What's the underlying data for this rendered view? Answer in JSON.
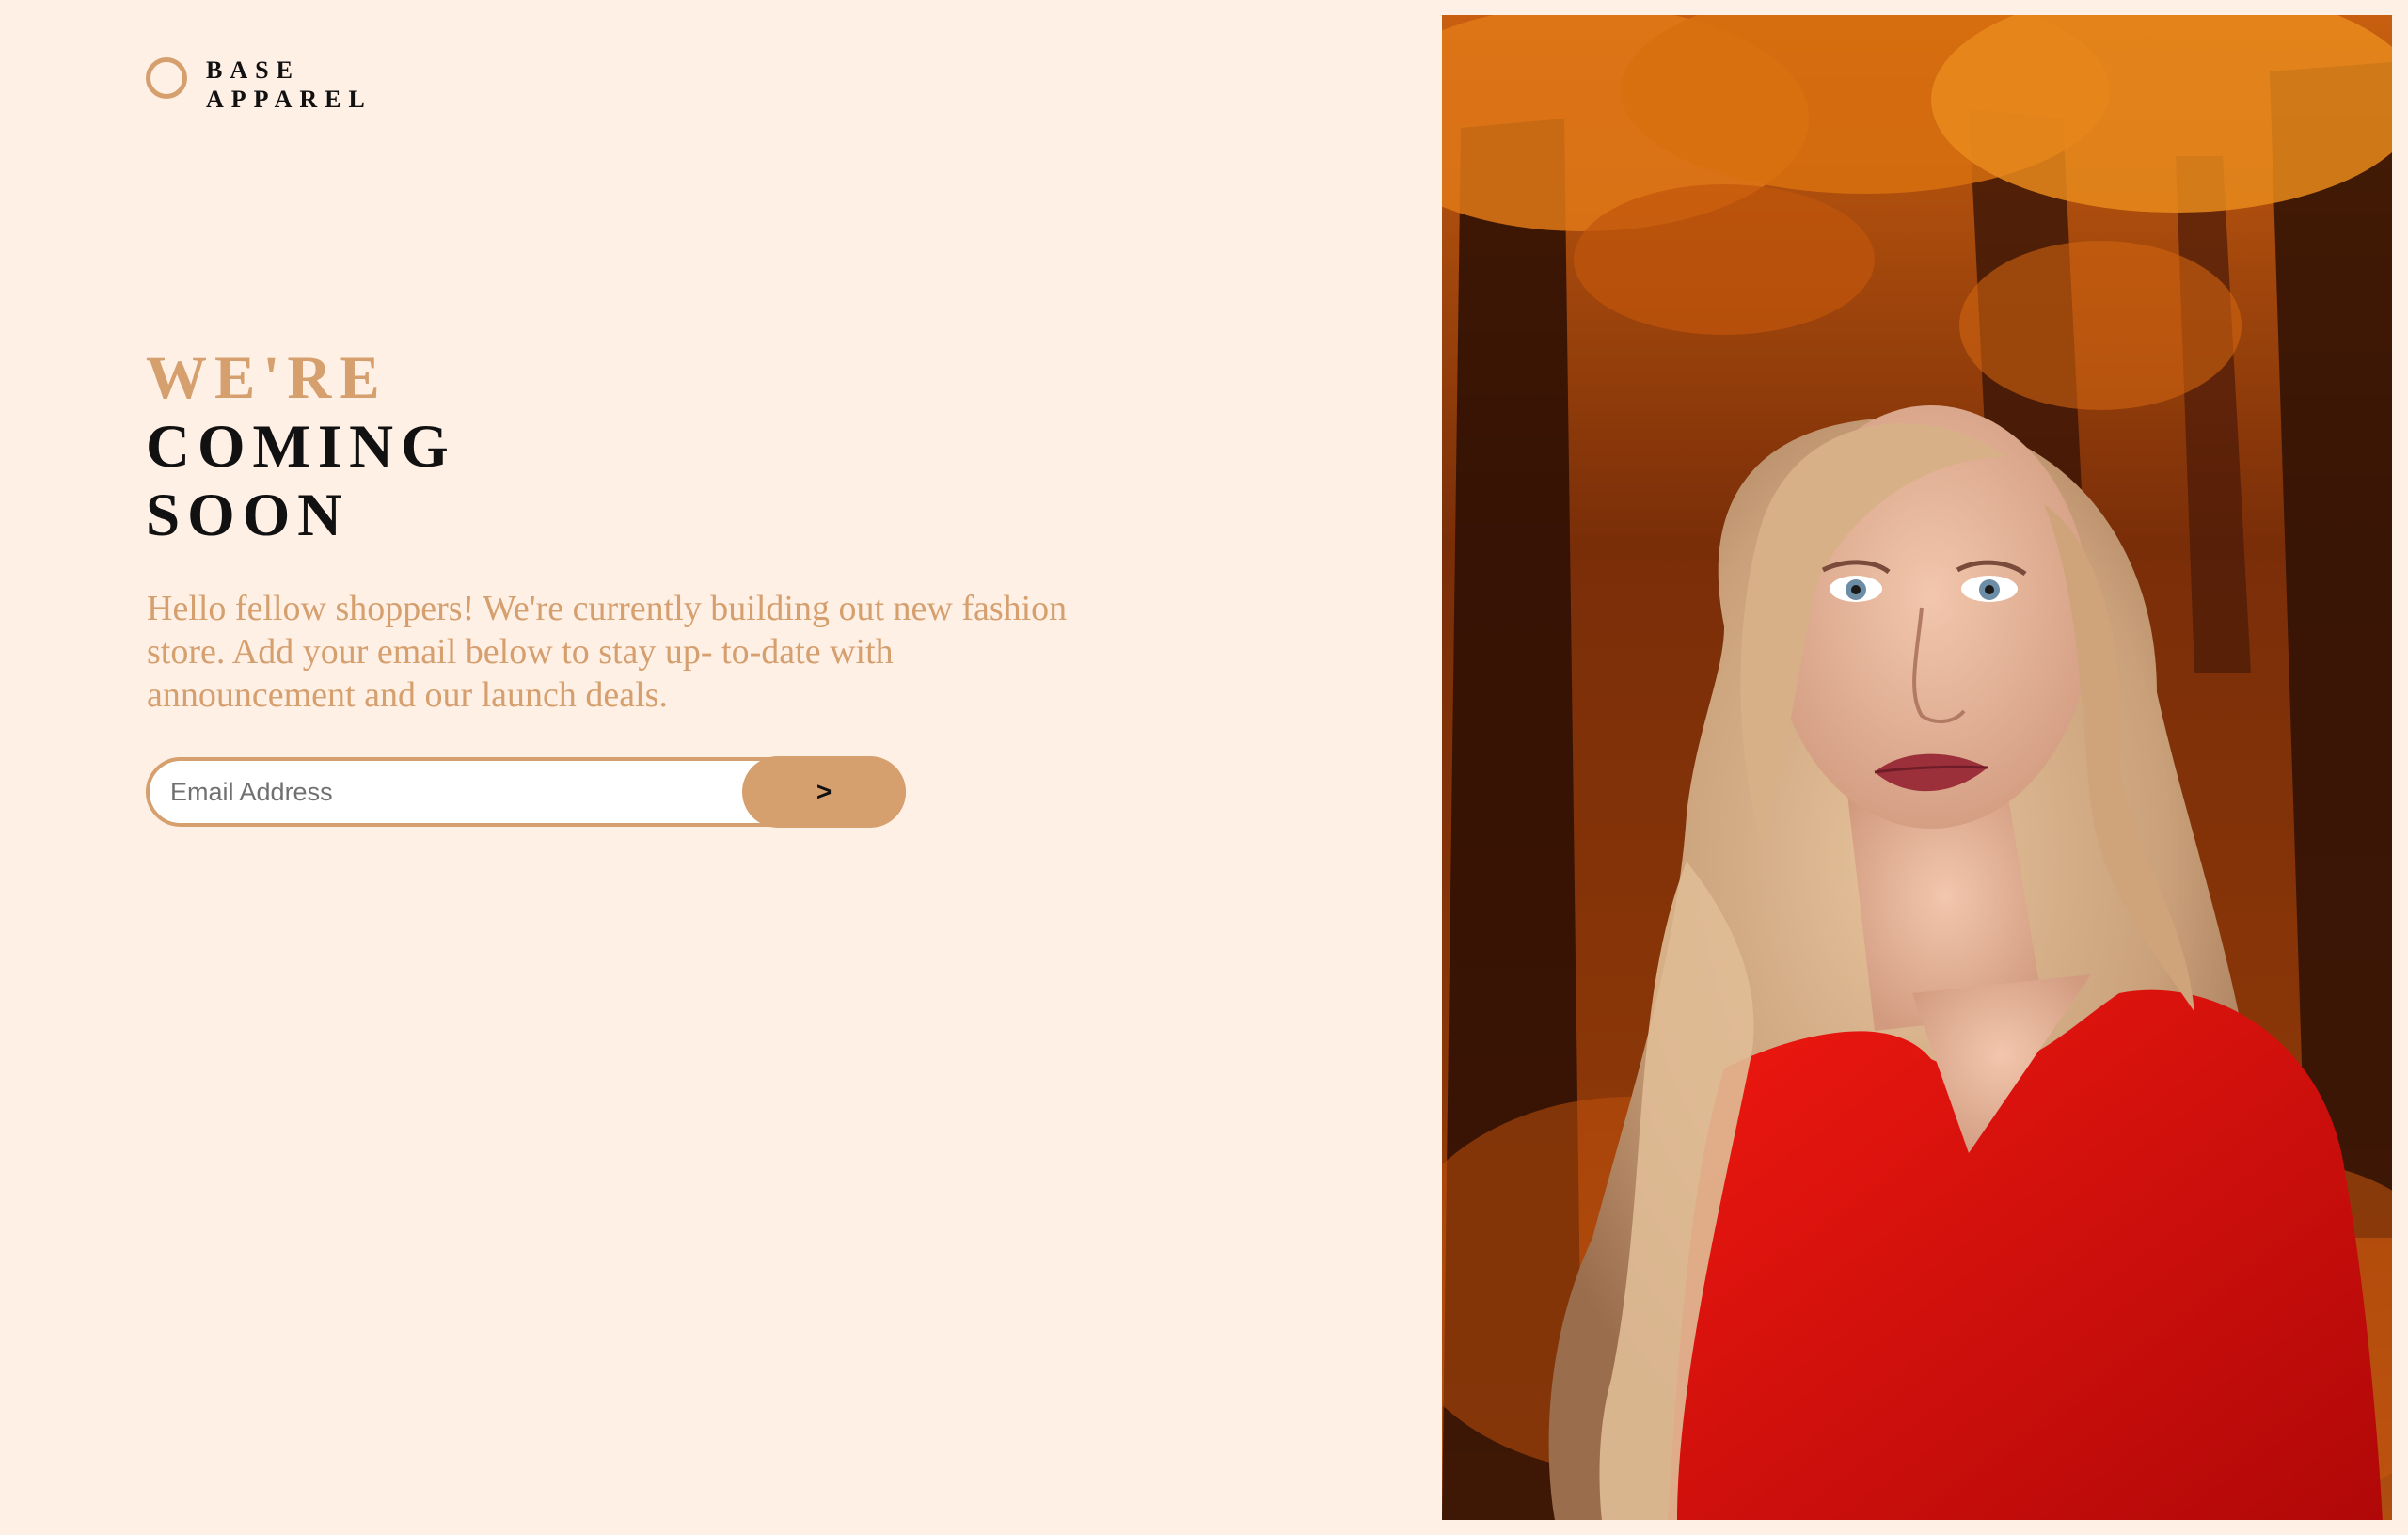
{
  "brand": {
    "line1": "BASE",
    "line2": "APPAREL",
    "accent_color": "#d59f6e"
  },
  "headline": {
    "accent": "WE'RE",
    "line2": "COMING",
    "line3": "SOON"
  },
  "description": "Hello fellow shoppers! We're currently building out new fashion store. Add your email below to stay up- to-date with announcement and our launch deals.",
  "signup": {
    "placeholder": "Email Address",
    "value": "",
    "submit_label": ">"
  },
  "colors": {
    "background": "#fff0e6",
    "accent": "#d59f6e",
    "text": "#111111"
  },
  "hero": {
    "subject": "woman with long wavy blonde hair in red sweater, autumn forest background"
  }
}
